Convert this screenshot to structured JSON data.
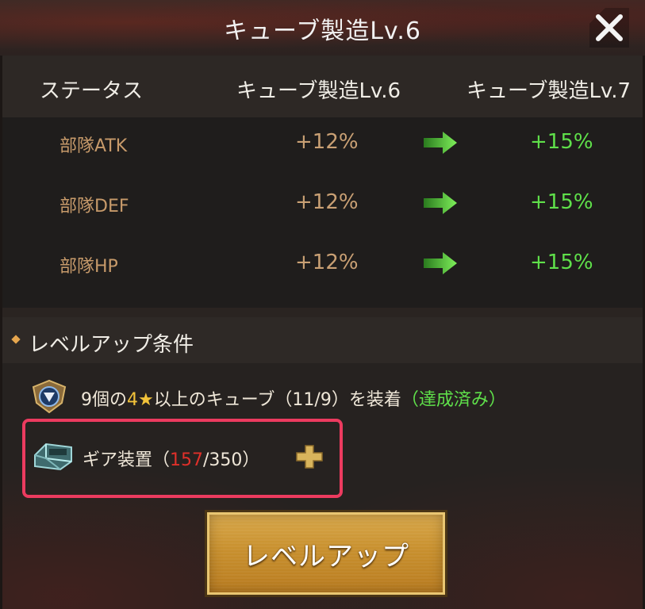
{
  "window": {
    "title": "キューブ製造Lv.6",
    "close_icon": "close-x"
  },
  "status_table": {
    "headers": [
      "ステータス",
      "キューブ製造Lv.6",
      "キューブ製造Lv.7"
    ],
    "rows": [
      {
        "label": "部隊ATK",
        "current": "+12%",
        "next": "+15%"
      },
      {
        "label": "部隊DEF",
        "current": "+12%",
        "next": "+15%"
      },
      {
        "label": "部隊HP",
        "current": "+12%",
        "next": "+15%"
      }
    ],
    "arrow_icon": "right-arrow"
  },
  "conditions": {
    "title": "レベルアップ条件",
    "items": [
      {
        "icon": "rank-badge",
        "prefix": "9個の",
        "highlight": "4★",
        "middle": "以上のキューブ（11/9）を装着",
        "status": "（達成済み）"
      },
      {
        "icon": "gear-device",
        "prefix": "ギア装置（",
        "have": "157",
        "need": "/350",
        "suffix": "）"
      }
    ]
  },
  "buttons": {
    "level_up": "レベルアップ",
    "add_icon": "plus"
  },
  "colors": {
    "accent_gold": "#c9a074",
    "positive_green": "#5fe04a",
    "insufficient_red": "#e0302a",
    "highlight_border": "#ec3b5f"
  }
}
